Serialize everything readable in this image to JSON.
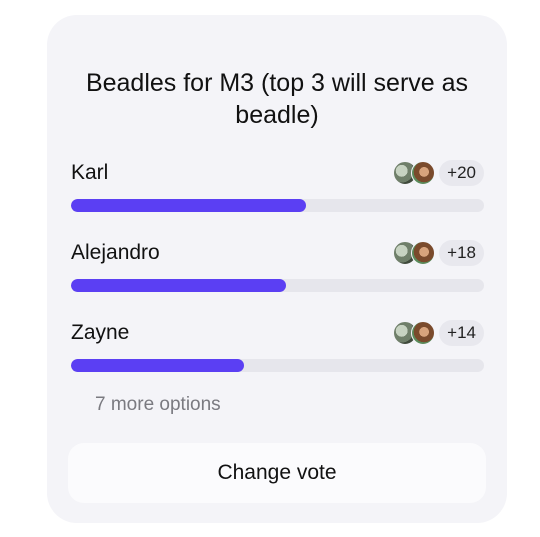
{
  "poll": {
    "title": "Beadles for M3 (top 3 will serve as beadle)",
    "options": [
      {
        "name": "Karl",
        "votes_label": "+20",
        "fraction": 0.57
      },
      {
        "name": "Alejandro",
        "votes_label": "+18",
        "fraction": 0.52
      },
      {
        "name": "Zayne",
        "votes_label": "+14",
        "fraction": 0.42
      }
    ],
    "more_options": "7 more options",
    "change_vote_label": "Change vote"
  },
  "colors": {
    "accent": "#5b3ff3",
    "track": "#e6e6ec",
    "card": "#f4f4f8"
  }
}
